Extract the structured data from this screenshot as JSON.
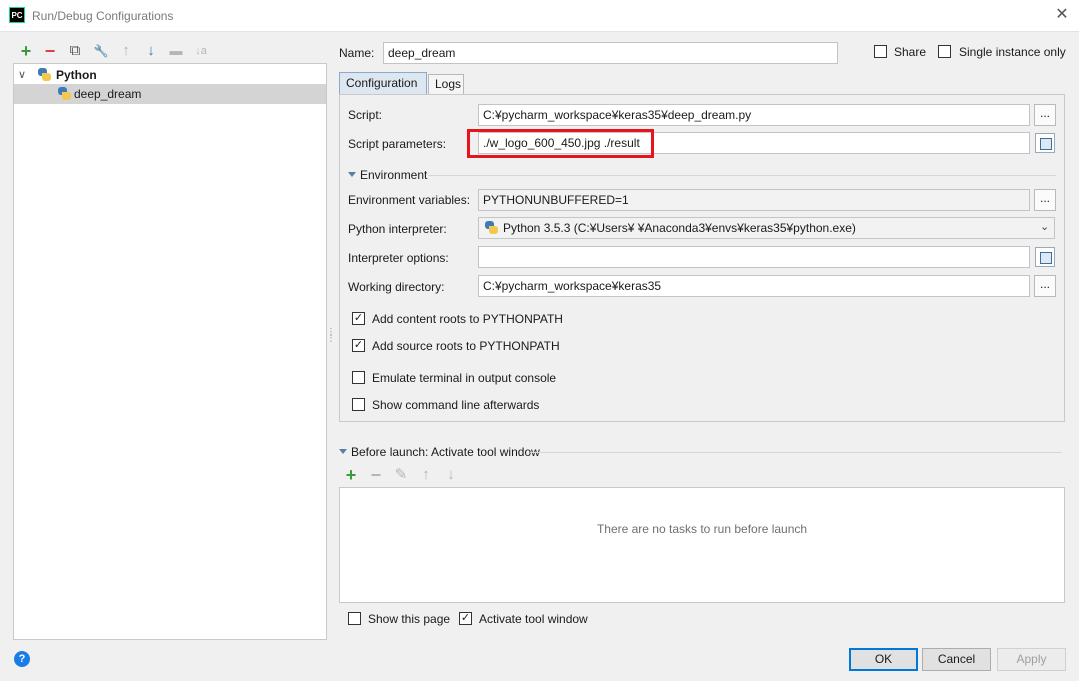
{
  "window": {
    "app_icon_text": "PC",
    "title": "Run/Debug Configurations",
    "close_glyph": "✕"
  },
  "toolbar": {
    "add": "+",
    "remove": "−",
    "copy": "⧉",
    "edit_defaults": "🔧",
    "move_up": "↑",
    "move_down": "↓",
    "folder": "▬",
    "sort": "↓a"
  },
  "tree": {
    "expand_glyph": "∨",
    "root": "Python",
    "child": "deep_dream"
  },
  "header": {
    "name_label": "Name:",
    "name_value": "deep_dream",
    "share_label": "Share",
    "single_instance_label": "Single instance only"
  },
  "tabs": [
    {
      "label": "Configuration"
    },
    {
      "label": "Logs"
    }
  ],
  "config": {
    "script_label": "Script:",
    "script_value": "C:¥pycharm_workspace¥keras35¥deep_dream.py",
    "params_label": "Script parameters:",
    "params_value": "./w_logo_600_450.jpg ./result",
    "environment_label": "Environment",
    "env_vars_label": "Environment variables:",
    "env_vars_value": "PYTHONUNBUFFERED=1",
    "interpreter_label": "Python interpreter:",
    "interpreter_value": "Python 3.5.3 (C:¥Users¥            ¥Anaconda3¥envs¥keras35¥python.exe)",
    "interp_options_label": "Interpreter options:",
    "interp_options_value": "",
    "workdir_label": "Working directory:",
    "workdir_value": "C:¥pycharm_workspace¥keras35",
    "browse_label": "...",
    "check_glyph": "✓",
    "checkboxes": [
      {
        "label": "Add content roots to PYTHONPATH",
        "checked": true
      },
      {
        "label": "Add source roots to PYTHONPATH",
        "checked": true
      },
      {
        "label": "Emulate terminal in output console",
        "checked": false
      },
      {
        "label": "Show command line afterwards",
        "checked": false
      }
    ]
  },
  "before_launch": {
    "title": "Before launch: Activate tool window",
    "add": "+",
    "remove": "−",
    "edit": "✎",
    "up": "↑",
    "down": "↓",
    "empty_text": "There are no tasks to run before launch",
    "show_page_label": "Show this page",
    "activate_label": "Activate tool window"
  },
  "buttons": {
    "ok": "OK",
    "cancel": "Cancel",
    "apply": "Apply",
    "help": "?"
  },
  "colors": {
    "accent": "#0078d7",
    "highlight_box": "#e8141d",
    "add_green": "#3b9a3b",
    "remove_red": "#d9413f"
  }
}
